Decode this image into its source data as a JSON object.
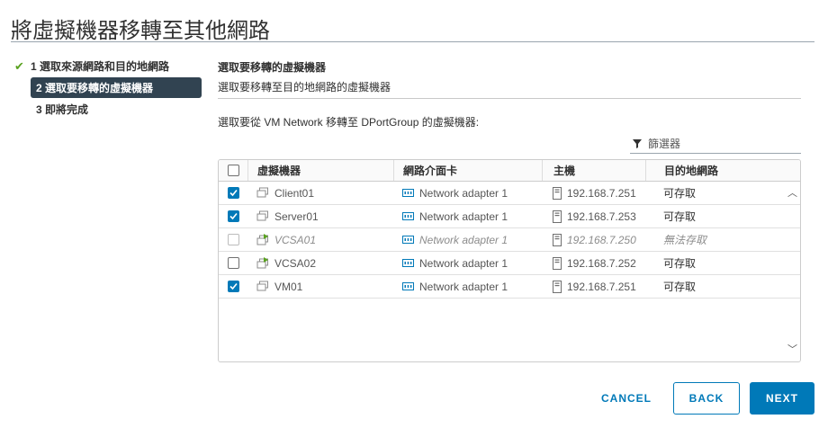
{
  "dialog": {
    "title": "將虛擬機器移轉至其他網路"
  },
  "steps": [
    {
      "label": "1 選取來源網路和目的地網路",
      "state": "done"
    },
    {
      "label": "2 選取要移轉的虛擬機器",
      "state": "active"
    },
    {
      "label": "3 即將完成",
      "state": "pending"
    }
  ],
  "section": {
    "heading": "選取要移轉的虛擬機器",
    "subheading": "選取要移轉至目的地網路的虛擬機器",
    "instruction": "選取要從 VM Network 移轉至 DPortGroup 的虛擬機器:"
  },
  "filter": {
    "placeholder": "篩選器",
    "icon": "funnel-icon"
  },
  "grid": {
    "columns": {
      "vm": "虛擬機器",
      "nic": "網路介面卡",
      "host": "主機",
      "network": "目的地網路"
    },
    "rows": [
      {
        "checked": true,
        "disabled": false,
        "vm": "Client01",
        "vm_icon": "vm-icon",
        "nic": "Network adapter 1",
        "host": "192.168.7.251",
        "network": "可存取"
      },
      {
        "checked": true,
        "disabled": false,
        "vm": "Server01",
        "vm_icon": "vm-icon",
        "nic": "Network adapter 1",
        "host": "192.168.7.253",
        "network": "可存取"
      },
      {
        "checked": false,
        "disabled": true,
        "vm": "VCSA01",
        "vm_icon": "vm-powered-on-icon",
        "nic": "Network adapter 1",
        "host": "192.168.7.250",
        "network": "無法存取"
      },
      {
        "checked": false,
        "disabled": false,
        "vm": "VCSA02",
        "vm_icon": "vm-powered-on-icon",
        "nic": "Network adapter 1",
        "host": "192.168.7.252",
        "network": "可存取"
      },
      {
        "checked": true,
        "disabled": false,
        "vm": "VM01",
        "vm_icon": "vm-icon",
        "nic": "Network adapter 1",
        "host": "192.168.7.251",
        "network": "可存取"
      }
    ]
  },
  "buttons": {
    "cancel": "CANCEL",
    "back": "BACK",
    "next": "NEXT"
  },
  "colors": {
    "accent": "#0079b8",
    "active_step_bg": "#314351",
    "check_green": "#5aa220",
    "power_green": "#5aa220"
  }
}
